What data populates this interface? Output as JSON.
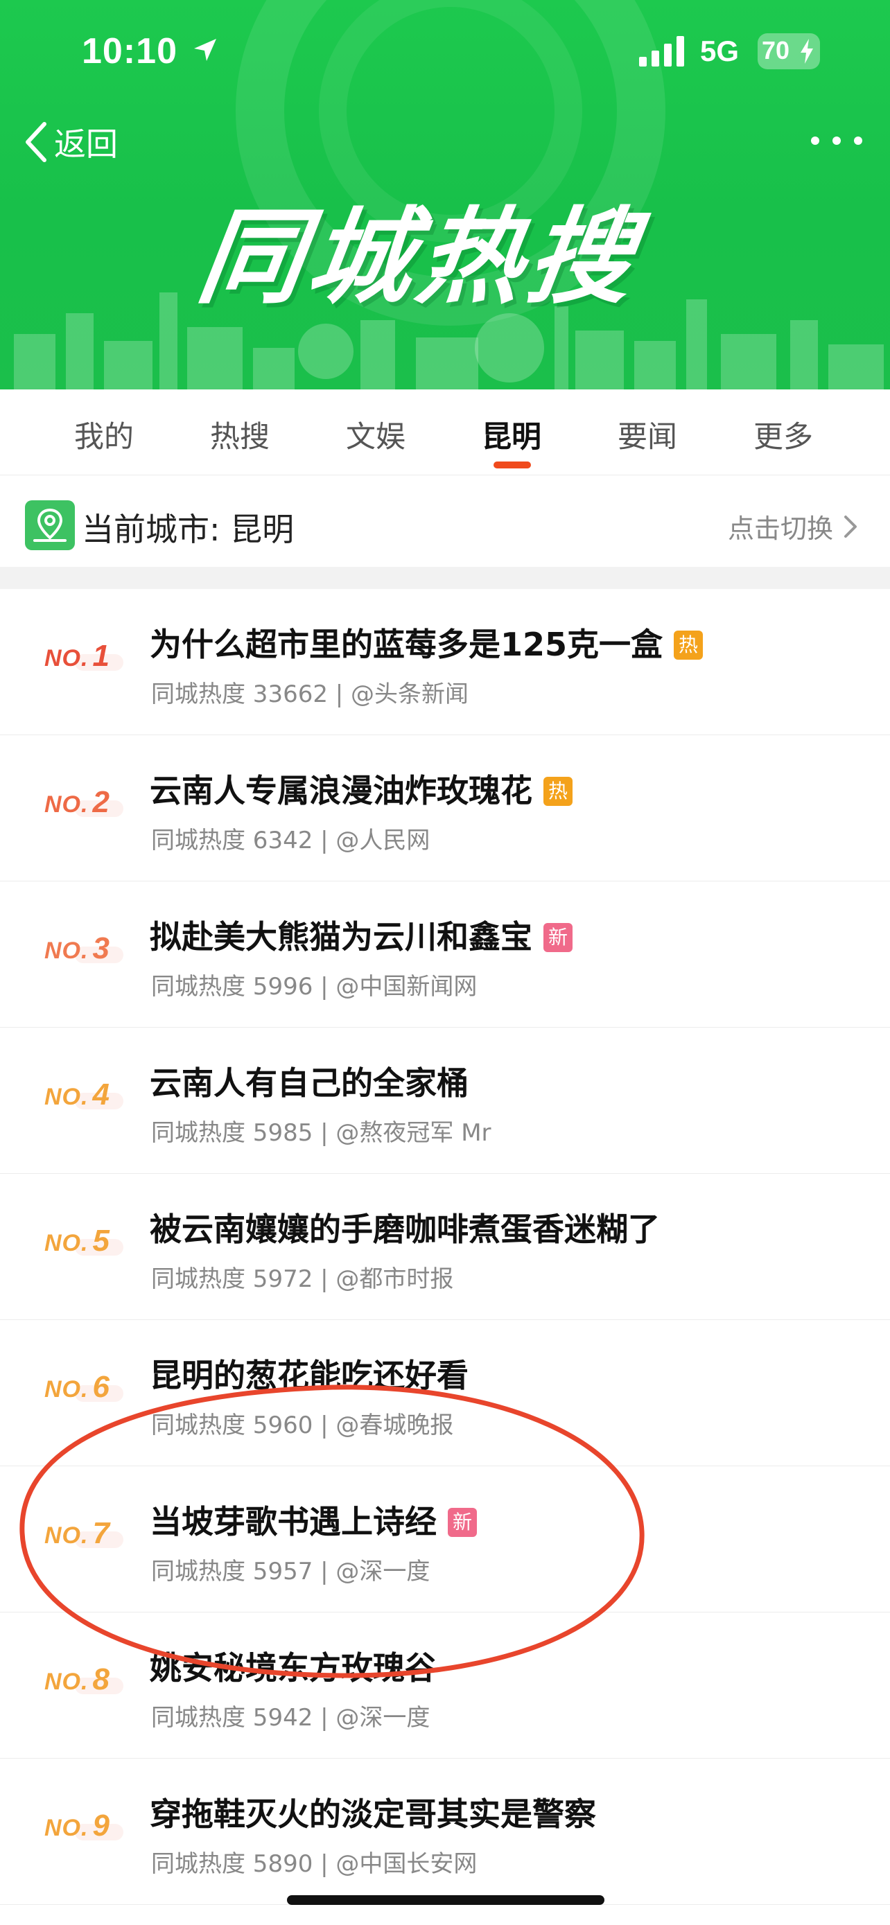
{
  "status_bar": {
    "time": "10:10",
    "network": "5G",
    "battery": "70"
  },
  "header": {
    "back_label": "返回",
    "hero_title": "同城热搜"
  },
  "tabs": [
    {
      "label": "我的"
    },
    {
      "label": "热搜"
    },
    {
      "label": "文娱"
    },
    {
      "label": "昆明",
      "active": true
    },
    {
      "label": "要闻"
    },
    {
      "label": "更多"
    }
  ],
  "city": {
    "label": "当前城市: 昆明",
    "switch_label": "点击切换"
  },
  "colors": {
    "brand_green": "#1dc94e",
    "accent_red": "#f04a1c",
    "hot_badge": "#f4a21b",
    "new_badge": "#f06a8a"
  },
  "items": [
    {
      "rank_no": "NO.",
      "rank_num": "1",
      "title": "为什么超市里的蓝莓多是125克一盒",
      "badge": "热",
      "meta": "同城热度 33662 | @头条新闻",
      "rank_color": "#e8503a"
    },
    {
      "rank_no": "NO.",
      "rank_num": "2",
      "title": "云南人专属浪漫油炸玫瑰花",
      "badge": "热",
      "meta": "同城热度 6342 | @人民网",
      "rank_color": "#ee6a46"
    },
    {
      "rank_no": "NO.",
      "rank_num": "3",
      "title": "拟赴美大熊猫为云川和鑫宝",
      "badge": "新",
      "meta": "同城热度 5996 | @中国新闻网",
      "rank_color": "#f07a50"
    },
    {
      "rank_no": "NO.",
      "rank_num": "4",
      "title": "云南人有自己的全家桶",
      "badge": "",
      "meta": "同城热度 5985 | @熬夜冠军 Mr",
      "rank_color": "#f3a53c"
    },
    {
      "rank_no": "NO.",
      "rank_num": "5",
      "title": "被云南孃孃的手磨咖啡煮蛋香迷糊了",
      "badge": "",
      "meta": "同城热度 5972 | @都市时报",
      "rank_color": "#f3a53c"
    },
    {
      "rank_no": "NO.",
      "rank_num": "6",
      "title": "昆明的葱花能吃还好看",
      "badge": "",
      "meta": "同城热度 5960 | @春城晚报",
      "rank_color": "#f3a53c"
    },
    {
      "rank_no": "NO.",
      "rank_num": "7",
      "title": "当坡芽歌书遇上诗经",
      "badge": "新",
      "meta": "同城热度 5957 | @深一度",
      "rank_color": "#f3a53c"
    },
    {
      "rank_no": "NO.",
      "rank_num": "8",
      "title": "姚安秘境东方玫瑰谷",
      "badge": "",
      "meta": "同城热度 5942 | @深一度",
      "rank_color": "#f3a53c"
    },
    {
      "rank_no": "NO.",
      "rank_num": "9",
      "title": "穿拖鞋灭火的淡定哥其实是警察",
      "badge": "",
      "meta": "同城热度 5890 | @中国长安网",
      "rank_color": "#f3a53c"
    }
  ]
}
